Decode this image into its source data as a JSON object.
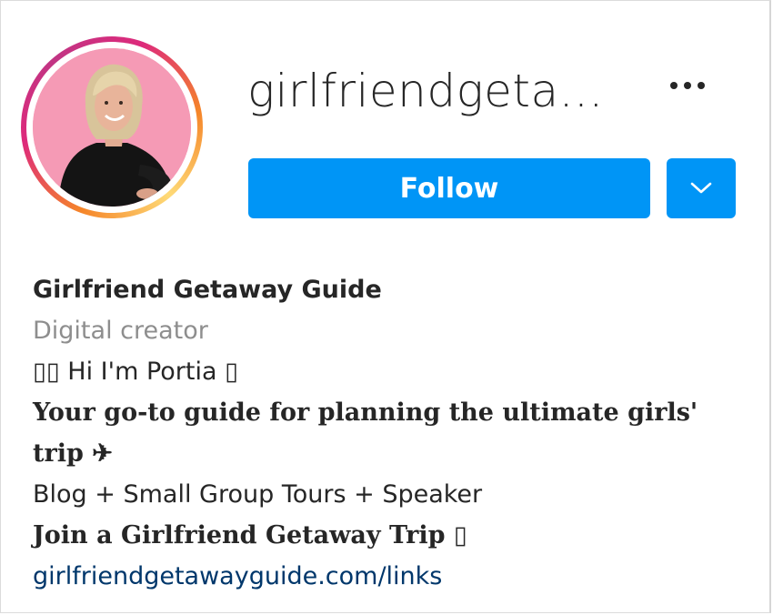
{
  "profile": {
    "username": "girlfriendgeta...",
    "follow_label": "Follow",
    "full_name": "Girlfriend Getaway Guide",
    "category": "Digital creator",
    "bio": {
      "line1": "▯▯ Hi I'm Portia ▯",
      "line2a": "Your go-to guide for planning the ultimate girls'",
      "line2b": "trip ✈",
      "line3": "Blog + Small Group Tours + Speaker",
      "line4": "Join a Girlfriend Getaway Trip ▯"
    },
    "link": "girlfriendgetawayguide.com/links"
  },
  "icons": {
    "more": "more-options-icon",
    "dropdown": "chevron-down-icon"
  },
  "colors": {
    "follow_button": "#0095f6",
    "link": "#00376b",
    "category": "#8e8e8e",
    "avatar_background": "#f59ab5"
  }
}
